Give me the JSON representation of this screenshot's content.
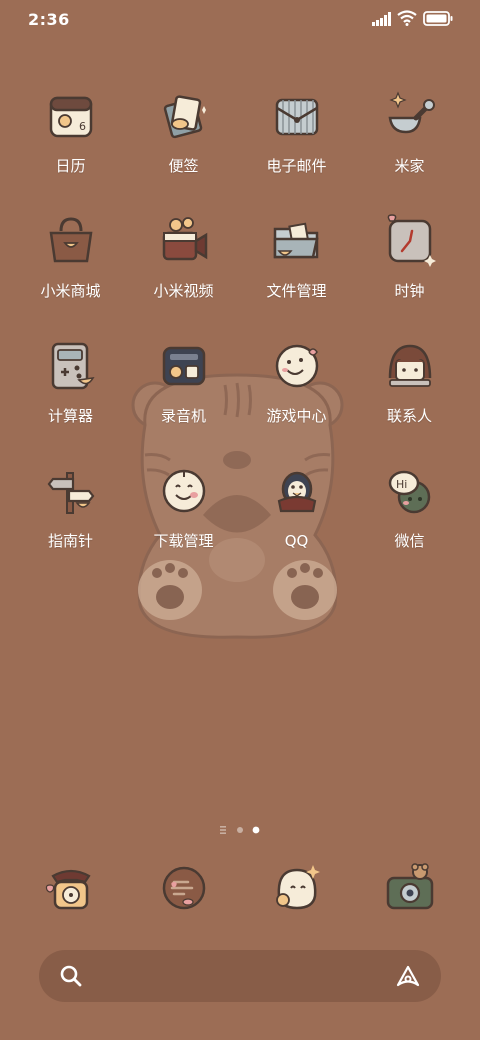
{
  "status_bar": {
    "time": "2:36"
  },
  "apps": [
    {
      "label": "日历",
      "icon": "calendar-icon"
    },
    {
      "label": "便签",
      "icon": "notes-icon"
    },
    {
      "label": "电子邮件",
      "icon": "mail-icon"
    },
    {
      "label": "米家",
      "icon": "mijia-icon"
    },
    {
      "label": "小米商城",
      "icon": "shop-bag-icon"
    },
    {
      "label": "小米视频",
      "icon": "video-camera-icon"
    },
    {
      "label": "文件管理",
      "icon": "folder-icon"
    },
    {
      "label": "时钟",
      "icon": "clock-icon"
    },
    {
      "label": "计算器",
      "icon": "calculator-icon"
    },
    {
      "label": "录音机",
      "icon": "recorder-icon"
    },
    {
      "label": "游戏中心",
      "icon": "game-center-icon"
    },
    {
      "label": "联系人",
      "icon": "contacts-icon"
    },
    {
      "label": "指南针",
      "icon": "compass-signpost-icon"
    },
    {
      "label": "下载管理",
      "icon": "download-icon"
    },
    {
      "label": "QQ",
      "icon": "qq-penguin-icon"
    },
    {
      "label": "微信",
      "icon": "wechat-icon"
    }
  ],
  "dock": [
    {
      "icon": "phone-icon"
    },
    {
      "icon": "messages-icon"
    },
    {
      "icon": "browser-ghost-icon"
    },
    {
      "icon": "camera-icon"
    }
  ],
  "page_indicator": {
    "pages": 3,
    "current": 3
  },
  "colors": {
    "background": "#9c6d55",
    "icon_dark": "#4a3a32",
    "icon_cream": "#f6ecd9"
  }
}
